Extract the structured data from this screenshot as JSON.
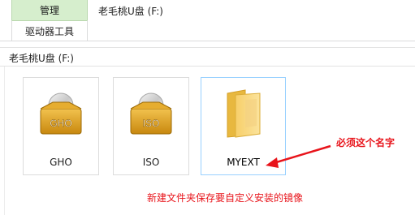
{
  "ribbon": {
    "context_tab_label": "管理",
    "window_title": "老毛桃U盘 (F:)",
    "tab_label": "驱动器工具"
  },
  "address_bar": {
    "path": "老毛桃U盘 (F:)"
  },
  "files": [
    {
      "name": "GHO",
      "icon": "gho-image-file-icon",
      "icon_text": "GHO"
    },
    {
      "name": "ISO",
      "icon": "iso-image-file-icon",
      "icon_text": "ISO"
    },
    {
      "name": "MYEXT",
      "icon": "folder-icon",
      "selected": true
    }
  ],
  "annotations": {
    "must_name": "必须这个名字",
    "instruction": "新建文件夹保存要自定义安装的镜像"
  },
  "colors": {
    "context_tab_bg": "#d6eecd",
    "annotation_red": "#e8141b",
    "selection_border": "#99d1ff",
    "folder_yellow": "#f8d775"
  }
}
